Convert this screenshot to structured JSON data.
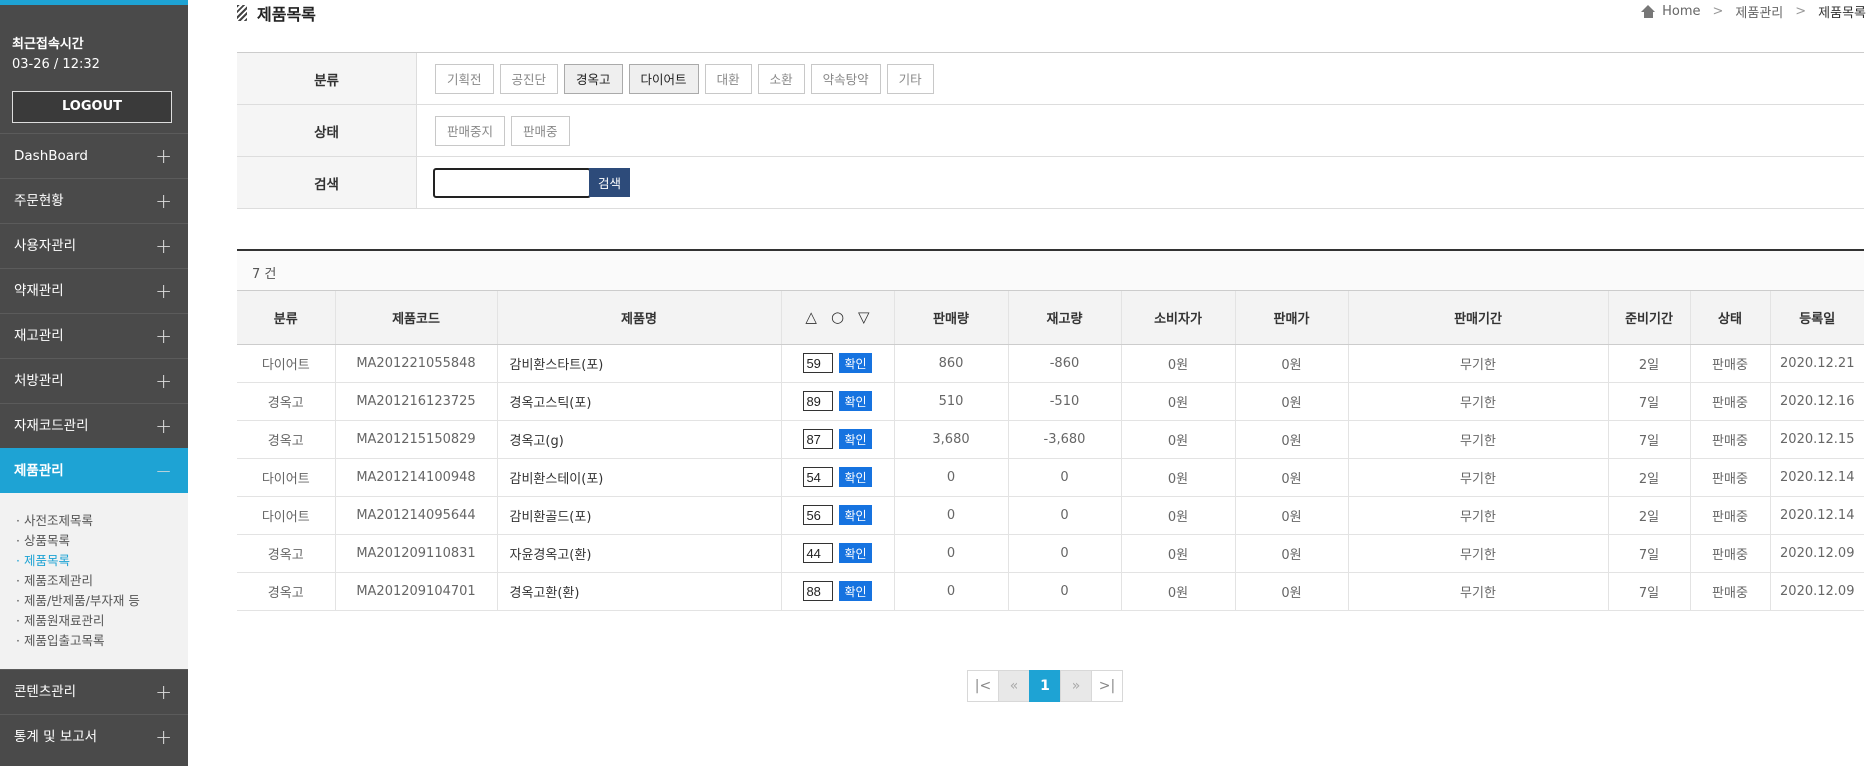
{
  "sidebar": {
    "recent_label": "최근접속시간",
    "recent_time": "03-26 / 12:32",
    "logout": "LOGOUT",
    "menu": [
      {
        "label": "DashBoard",
        "toggle": "+"
      },
      {
        "label": "주문현황",
        "toggle": "+"
      },
      {
        "label": "사용자관리",
        "toggle": "+"
      },
      {
        "label": "약재관리",
        "toggle": "+"
      },
      {
        "label": "재고관리",
        "toggle": "+"
      },
      {
        "label": "처방관리",
        "toggle": "+"
      },
      {
        "label": "자재코드관리",
        "toggle": "+"
      },
      {
        "label": "제품관리",
        "toggle": "−"
      }
    ],
    "submenu": [
      "· 사전조제목록",
      "· 상품목록",
      "· 제품목록",
      "· 제품조제관리",
      "· 제품/반제품/부자재 등",
      "· 제품원재료관리",
      "· 제품입출고목록"
    ],
    "menu_bottom": [
      {
        "label": "콘텐츠관리",
        "toggle": "+"
      },
      {
        "label": "통계 및 보고서",
        "toggle": "+"
      }
    ]
  },
  "header": {
    "title": "제품목록",
    "breadcrumb": {
      "home": "Home",
      "sep": ">",
      "level1": "제품관리",
      "current": "제품목록"
    }
  },
  "filter": {
    "category_label": "분류",
    "categories": [
      "기획전",
      "공진단",
      "경옥고",
      "다이어트",
      "대환",
      "소환",
      "약속탕약",
      "기타"
    ],
    "status_label": "상태",
    "statuses": [
      "판매중지",
      "판매중"
    ],
    "search_label": "검색",
    "search_value": "",
    "search_button": "검색"
  },
  "result": {
    "count_text": "7 건",
    "columns": [
      "분류",
      "제품코드",
      "제품명",
      "△ ○ ▽",
      "판매량",
      "재고량",
      "소비자가",
      "판매가",
      "판매기간",
      "준비기간",
      "상태",
      "등록일"
    ],
    "order_shapes": [
      "△",
      "○",
      "▽"
    ],
    "confirm_label": "확인",
    "rows": [
      {
        "category": "다이어트",
        "code": "MA201221055848",
        "name": "감비환스타트(포)",
        "order": "59",
        "sold": "860",
        "stock": "-860",
        "consumer_price": "0원",
        "price": "0원",
        "period": "무기한",
        "prep": "2일",
        "status": "판매중",
        "date": "2020.12.21"
      },
      {
        "category": "경옥고",
        "code": "MA201216123725",
        "name": "경옥고스틱(포)",
        "order": "89",
        "sold": "510",
        "stock": "-510",
        "consumer_price": "0원",
        "price": "0원",
        "period": "무기한",
        "prep": "7일",
        "status": "판매중",
        "date": "2020.12.16"
      },
      {
        "category": "경옥고",
        "code": "MA201215150829",
        "name": "경옥고(g)",
        "order": "87",
        "sold": "3,680",
        "stock": "-3,680",
        "consumer_price": "0원",
        "price": "0원",
        "period": "무기한",
        "prep": "7일",
        "status": "판매중",
        "date": "2020.12.15"
      },
      {
        "category": "다이어트",
        "code": "MA201214100948",
        "name": "감비환스테이(포)",
        "order": "54",
        "sold": "0",
        "stock": "0",
        "consumer_price": "0원",
        "price": "0원",
        "period": "무기한",
        "prep": "2일",
        "status": "판매중",
        "date": "2020.12.14"
      },
      {
        "category": "다이어트",
        "code": "MA201214095644",
        "name": "감비환골드(포)",
        "order": "56",
        "sold": "0",
        "stock": "0",
        "consumer_price": "0원",
        "price": "0원",
        "period": "무기한",
        "prep": "2일",
        "status": "판매중",
        "date": "2020.12.14"
      },
      {
        "category": "경옥고",
        "code": "MA201209110831",
        "name": "자윤경옥고(환)",
        "order": "44",
        "sold": "0",
        "stock": "0",
        "consumer_price": "0원",
        "price": "0원",
        "period": "무기한",
        "prep": "7일",
        "status": "판매중",
        "date": "2020.12.09"
      },
      {
        "category": "경옥고",
        "code": "MA201209104701",
        "name": "경옥고환(환)",
        "order": "88",
        "sold": "0",
        "stock": "0",
        "consumer_price": "0원",
        "price": "0원",
        "period": "무기한",
        "prep": "7일",
        "status": "판매중",
        "date": "2020.12.09"
      }
    ]
  },
  "pagination": {
    "first": "|<",
    "prev": "«",
    "current": "1",
    "next": "»",
    "last": ">|"
  },
  "colors": {
    "accent": "#1ea3d4",
    "sidebar_bg": "#4a4a4a",
    "search_button": "#2d4b7a",
    "confirm_button": "#1673e0"
  }
}
